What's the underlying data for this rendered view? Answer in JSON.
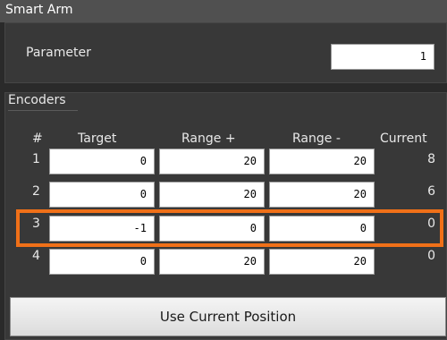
{
  "window": {
    "title": "Smart Arm"
  },
  "parameter": {
    "label": "Parameter",
    "value": "1"
  },
  "encoders": {
    "title": "Encoders",
    "columns": [
      "#",
      "Target",
      "Range +",
      "Range -",
      "Current"
    ],
    "rows": [
      {
        "num": "1",
        "target": "0",
        "range_plus": "20",
        "range_minus": "20",
        "current": "8"
      },
      {
        "num": "2",
        "target": "0",
        "range_plus": "20",
        "range_minus": "20",
        "current": "6"
      },
      {
        "num": "3",
        "target": "-1",
        "range_plus": "0",
        "range_minus": "0",
        "current": "0"
      },
      {
        "num": "4",
        "target": "0",
        "range_plus": "20",
        "range_minus": "20",
        "current": "0"
      }
    ],
    "highlighted_row": "3"
  },
  "button": {
    "label": "Use Current Position"
  },
  "colors": {
    "highlight": "#f07018",
    "background": "#2a2a2a",
    "panel": "#383838",
    "titlebar": "#505050"
  }
}
